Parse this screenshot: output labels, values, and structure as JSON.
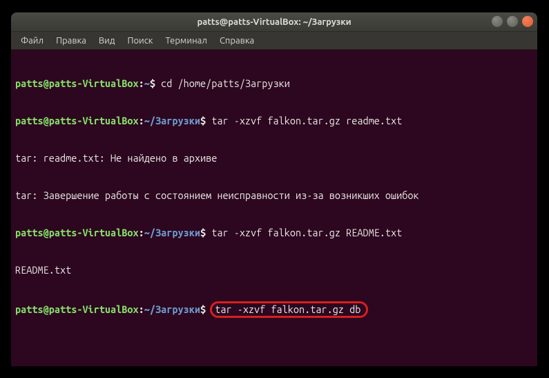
{
  "window": {
    "title": "patts@patts-VirtualBox: ~/Загрузки"
  },
  "menubar": {
    "items": [
      "Файл",
      "Правка",
      "Вид",
      "Поиск",
      "Терминал",
      "Справка"
    ]
  },
  "prompt": {
    "user": "patts@patts-VirtualBox",
    "colon": ":",
    "path_home": "~",
    "path_downloads": "~/Загрузки",
    "dollar": "$"
  },
  "lines": {
    "cmd1": " cd /home/patts/Загрузки",
    "cmd2": " tar -xzvf falkon.tar.gz readme.txt",
    "out1": "tar: readme.txt: Не найдено в архиве",
    "out2": "tar: Завершение работы с состоянием неисправности из-за возникших ошибок",
    "cmd3": " tar -xzvf falkon.tar.gz README.txt",
    "out3": "README.txt",
    "cmd4": "tar -xzvf falkon.tar.gz db"
  },
  "controls": {
    "min": "−",
    "max": "□",
    "close": "×"
  }
}
